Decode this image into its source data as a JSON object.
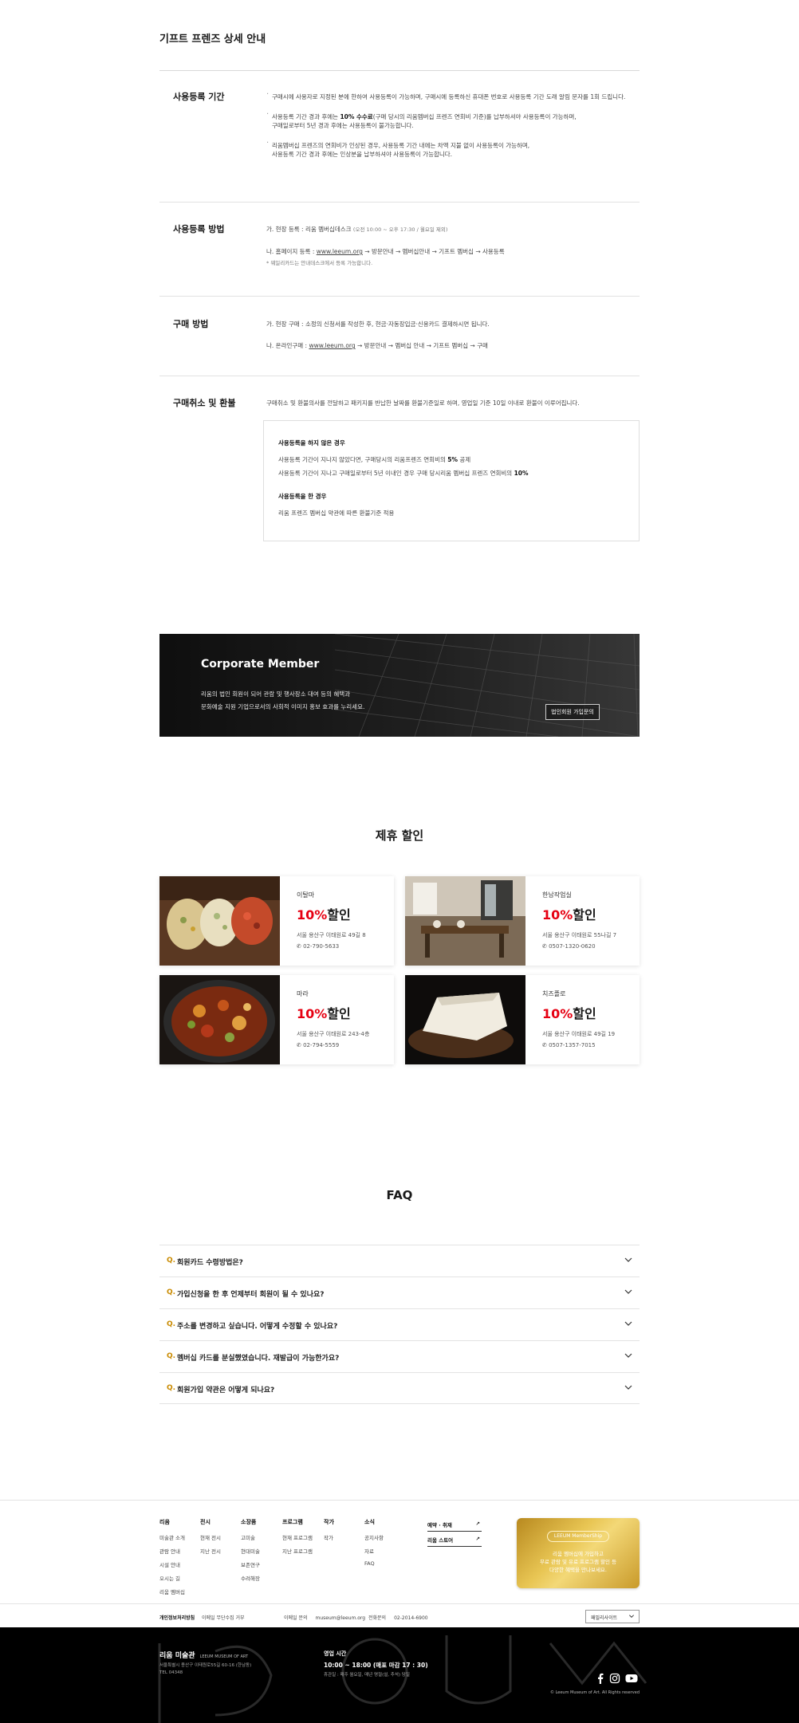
{
  "page_title": "기프트 프렌즈 상세 안내",
  "sections": {
    "period": {
      "title": "사용등록 기간",
      "bullets": [
        [
          "구매시에 사용자로 지정된 분에 한하여 사용등록이 가능하며, 구매시에 등록하신 휴대폰 번호로 사용등록 기간 도래 알림 문자를 1회 드립니다."
        ],
        [
          "사용등록 기간 경과 후에는 ",
          "10% 수수료",
          "(구매 당시의 리움멤버십 프렌즈 연회비 기준)를 납부하셔야 사용등록이 가능하며,",
          "구매일로부터 5년 경과 후에는 사용등록이 불가능합니다."
        ],
        [
          "리움멤버십 프렌즈의 연회비가 인상된 경우, 사용등록 기간 내에는 차액 지불 없이 사용등록이 가능하며,",
          "사용등록 기간 경과 후에는 인상분을 납부하셔야 사용등록이 가능합니다."
        ]
      ]
    },
    "method": {
      "title": "사용등록 방법",
      "line1": "가. 현장 등록 : 리움 멤버십데스크 ",
      "line1_small": "(오전 10:00 ~ 오후 17:30 / 월요일 제외)",
      "line2_pre": "나. 홈페이지 등록 : ",
      "line2_link": "www.leeum.org",
      "line2_post": " → 방문안내 → 멤버십안내 → 기프트 멤버십 → 사용등록",
      "note": "* 웨일리카드는 안내데스크에서 등록 가능합니다."
    },
    "purchase": {
      "title": "구매 방법",
      "line1": "가. 현장 구매 : 소정의 신청서를 작성한 후, 현금·자동장입금·신용카드 결제하시면 됩니다.",
      "line2_pre": "나. 온라인구매 : ",
      "line2_link": "www.leeum.org",
      "line2_post": " → 방문안내 → 멤버십 안내 → 기프트 멤버십 → 구매"
    },
    "refund": {
      "title": "구매취소 및 환불",
      "desc": "구매취소 및 환불의사를 전달하고 패키지를 반납한 날짜를 환불기준일로 하며, 영업일 기준 10일 이내로 환불이 이루어집니다.",
      "box": {
        "h1": "사용등록을 하지 않은 경우",
        "r1_pre": "사용등록 기간이 지나지 않았다면, 구매당시의 리움프렌즈 연회비의 ",
        "r1_em": "5%",
        "r1_post": " 공제",
        "r2_pre": "사용등록 기간이 지나고 구매일로부터 5년 이내인 경우 구매 당시리움 멤버십 프렌즈 연회비의 ",
        "r2_em": "10%",
        "h2": "사용등록을 한 경우",
        "r3": "리움 프렌즈 멤버십 약관에 따른 환불기준 적용"
      }
    }
  },
  "corporate": {
    "title": "Corporate Member",
    "desc1": "리움의 법인 회원이 되어 관람 및 행사장소 대여 등의 혜택과",
    "desc2": "문화예술 지원 기업으로서의 사회적 이미지 홍보 효과를 누리세요.",
    "button": "법인회원 가입문의"
  },
  "partners": {
    "heading": "제휴 할인",
    "pct": "10%",
    "suffix": "할인",
    "cards": [
      {
        "name": "이탈마",
        "addr": "서울 용산구 이태원로 49길 8",
        "tel": "02-790-5633"
      },
      {
        "name": "한남작업실",
        "addr": "서울 용산구 이태원로 55나길 7",
        "tel": "0507-1320-0620"
      },
      {
        "name": "마라",
        "addr": "서울 용산구 이태원로 243-4층",
        "tel": "02-794-5559"
      },
      {
        "name": "치즈플로",
        "addr": "서울 용산구 이태원로 49길 19",
        "tel": "0507-1357-7015"
      }
    ]
  },
  "faq": {
    "heading": "FAQ",
    "q_mark": "Q.",
    "items": [
      "회원카드 수령방법은?",
      "가입신청을 한 후 언제부터 회원이 될 수 있나요?",
      "주소를 변경하고 싶습니다. 어떻게 수정할 수 있나요?",
      "멤버십 카드를 분실했였습니다. 재발급이 가능한가요?",
      "회원가입 약관은 어떻게 되나요?"
    ]
  },
  "footer": {
    "cols": [
      {
        "h": "리움",
        "items": [
          "미술관 소개",
          "관람 안내",
          "시설 안내",
          "오시는 길",
          "리움 멤버십"
        ]
      },
      {
        "h": "전시",
        "items": [
          "현재 전시",
          "지난 전시"
        ]
      },
      {
        "h": "소장품",
        "items": [
          "고미술",
          "현대미술",
          "보존연구",
          "수려해장"
        ]
      },
      {
        "h": "프로그램",
        "items": [
          "현재 프로그램",
          "지난 프로그램"
        ]
      },
      {
        "h": "작가",
        "items": [
          "작가"
        ]
      },
      {
        "h": "소식",
        "items": [
          "공지사항",
          "자료",
          "FAQ"
        ]
      }
    ],
    "links": [
      "예약 · 취재",
      "리움 스토어"
    ],
    "link_arrow": "↗",
    "gold": {
      "badge": "LEEUM MemberShip",
      "line1": "리움 멤버십에 가입하고",
      "line2": "무료 관람 및 유료 프로그램 할인 등",
      "line3": "다양한 혜택을 만나보세요."
    },
    "privacy": "개인정보처리방침",
    "video": "이메일 무단수집 거부",
    "email_label": "이메일 문의",
    "email": "museum@leeum.org",
    "phone_label": "전화문의",
    "phone": "02-2014-6900",
    "family": "패밀리사이트",
    "brand": "리움 미술관",
    "brand_en": "LEEUM MUSEUM OF ART",
    "addr1": "서울특별시 용산구 이태원로55길 60-16 (한남동)",
    "addr2": "TEL 04348",
    "hours_title": "영업 시간",
    "hours": "10:00 ~ 18:00 (매표 마감 17 : 30)",
    "hours_sub": "휴관일 : 매주 월요일, 매년 명절(설, 추석) 당일",
    "copyright": "© Leeum Museum of Art. All Rights reserved"
  },
  "colors": {
    "accent_red": "#e60012",
    "faq_q": "#c98a00",
    "gold": "#e8c553"
  }
}
